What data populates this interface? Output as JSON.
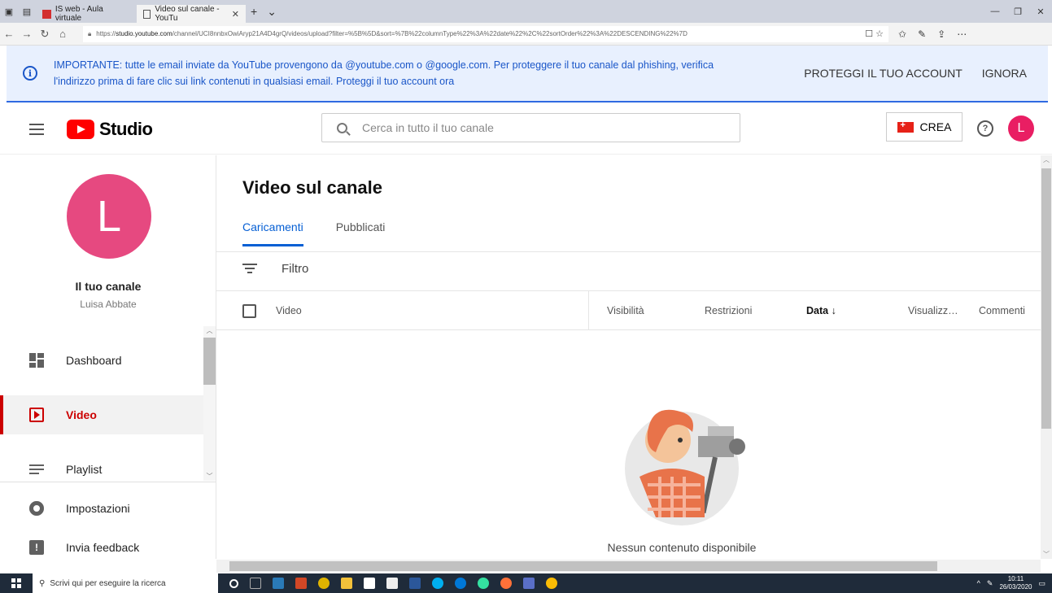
{
  "browser": {
    "tabs": [
      {
        "label": "IS web - Aula virtuale",
        "active": false
      },
      {
        "label": "Video sul canale - YouTu",
        "active": true
      }
    ],
    "url_prefix": "https://",
    "url_domain": "studio.youtube.com",
    "url_path": "/channel/UCI8nnbxOwiAryp21A4D4grQ/videos/upload?filter=%5B%5D&sort=%7B%22columnType%22%3A%22date%22%2C%22sortOrder%22%3A%22DESCENDING%22%7D"
  },
  "banner": {
    "message": "IMPORTANTE: tutte le email inviate da YouTube provengono da @youtube.com o @google.com. Per proteggere il tuo canale dal phishing, verifica l'indirizzo prima di fare clic sui link contenuti in qualsiasi email. Proteggi il tuo account ora",
    "action_protect": "PROTEGGI IL TUO ACCOUNT",
    "action_ignore": "IGNORA"
  },
  "header": {
    "logo_text": "Studio",
    "search_placeholder": "Cerca in tutto il tuo canale",
    "create_label": "CREA",
    "avatar_letter": "L"
  },
  "sidebar": {
    "avatar_letter": "L",
    "channel_title": "Il tuo canale",
    "channel_name": "Luisa Abbate",
    "items": [
      {
        "label": "Dashboard",
        "icon": "dashboard-icon"
      },
      {
        "label": "Video",
        "icon": "video-icon",
        "active": true
      },
      {
        "label": "Playlist",
        "icon": "playlist-icon"
      },
      {
        "label": "Impostazioni",
        "icon": "gear-icon"
      },
      {
        "label": "Invia feedback",
        "icon": "feedback-icon"
      }
    ]
  },
  "main": {
    "title": "Video sul canale",
    "tabs": [
      {
        "label": "Caricamenti",
        "active": true
      },
      {
        "label": "Pubblicati",
        "active": false
      }
    ],
    "filter_label": "Filtro",
    "columns": {
      "video": "Video",
      "visibility": "Visibilità",
      "restrictions": "Restrizioni",
      "date": "Data",
      "views": "Visualizz…",
      "comments": "Commenti"
    },
    "empty_text": "Nessun contenuto disponibile"
  },
  "taskbar": {
    "search_placeholder": "Scrivi qui per eseguire la ricerca",
    "time": "10:11",
    "date": "26/03/2020"
  },
  "colors": {
    "brand_red": "#ff0000",
    "active_blue": "#065fd4",
    "banner_bg": "#e8f0fe",
    "avatar_pink": "#e91e63"
  }
}
